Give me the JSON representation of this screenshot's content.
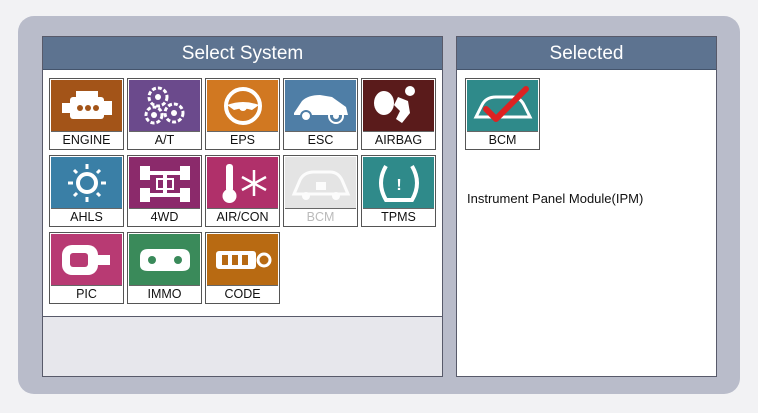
{
  "select_panel": {
    "title": "Select System",
    "tiles": [
      {
        "label": "ENGINE",
        "bg": "#a35418",
        "icon": "engine-icon"
      },
      {
        "label": "A/T",
        "bg": "#6b4a8c",
        "icon": "gears-icon"
      },
      {
        "label": "EPS",
        "bg": "#d17821",
        "icon": "steering-wheel-icon"
      },
      {
        "label": "ESC",
        "bg": "#4f7ea6",
        "icon": "car-skid-icon"
      },
      {
        "label": "AIRBAG",
        "bg": "#5a1b1b",
        "icon": "airbag-icon"
      },
      {
        "label": "AHLS",
        "bg": "#3a7fa6",
        "icon": "headlight-icon"
      },
      {
        "label": "4WD",
        "bg": "#8b2a6b",
        "icon": "drivetrain-icon"
      },
      {
        "label": "AIR/CON",
        "bg": "#b0306a",
        "icon": "thermometer-snowflake-icon"
      },
      {
        "label": "BCM",
        "bg": "#e4e4e4",
        "icon": "car-body-icon",
        "disabled": true
      },
      {
        "label": "TPMS",
        "bg": "#2f8a8a",
        "icon": "tire-pressure-icon"
      },
      {
        "label": "PIC",
        "bg": "#b83a73",
        "icon": "smart-key-icon"
      },
      {
        "label": "IMMO",
        "bg": "#3a8a5a",
        "icon": "immobilizer-key-icon"
      },
      {
        "label": "CODE",
        "bg": "#b86a12",
        "icon": "key-code-icon"
      }
    ]
  },
  "selected_panel": {
    "title": "Selected",
    "tile": {
      "label": "BCM",
      "bg": "#2f8a8a",
      "icon": "car-check-icon"
    },
    "description": "Instrument Panel Module(IPM)"
  }
}
